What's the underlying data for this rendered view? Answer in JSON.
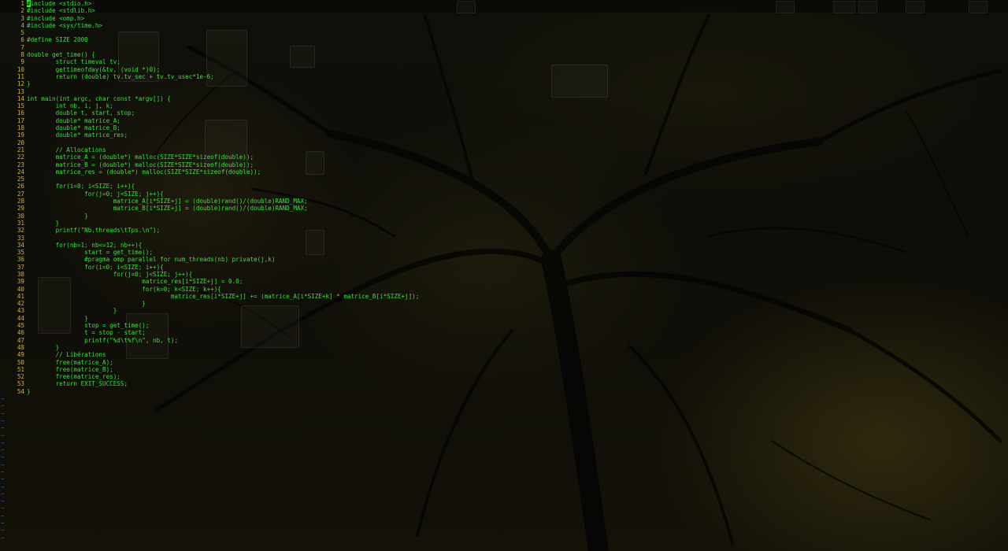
{
  "editor": {
    "lines": [
      {
        "num": "1",
        "text": "#include <stdio.h>"
      },
      {
        "num": "2",
        "text": "#include <stdlib.h>"
      },
      {
        "num": "3",
        "text": "#include <omp.h>"
      },
      {
        "num": "4",
        "text": "#include <sys/time.h>"
      },
      {
        "num": "5",
        "text": ""
      },
      {
        "num": "6",
        "text": "#define SIZE 2000"
      },
      {
        "num": "7",
        "text": ""
      },
      {
        "num": "8",
        "text": "double get_time() {"
      },
      {
        "num": "9",
        "text": "        struct timeval tv;"
      },
      {
        "num": "10",
        "text": "        gettimeofday(&tv, (void *)0);"
      },
      {
        "num": "11",
        "text": "        return (double) tv.tv_sec + tv.tv_usec*1e-6;"
      },
      {
        "num": "12",
        "text": "}"
      },
      {
        "num": "13",
        "text": ""
      },
      {
        "num": "14",
        "text": "int main(int argc, char const *argv[]) {"
      },
      {
        "num": "15",
        "text": "        int nb, i, j, k;"
      },
      {
        "num": "16",
        "text": "        double t, start, stop;"
      },
      {
        "num": "17",
        "text": "        double* matrice_A;"
      },
      {
        "num": "18",
        "text": "        double* matrice_B;"
      },
      {
        "num": "19",
        "text": "        double* matrice_res;"
      },
      {
        "num": "20",
        "text": ""
      },
      {
        "num": "21",
        "text": "        // Allocations"
      },
      {
        "num": "22",
        "text": "        matrice_A = (double*) malloc(SIZE*SIZE*sizeof(double));"
      },
      {
        "num": "23",
        "text": "        matrice_B = (double*) malloc(SIZE*SIZE*sizeof(double));"
      },
      {
        "num": "24",
        "text": "        matrice_res = (double*) malloc(SIZE*SIZE*sizeof(double));"
      },
      {
        "num": "25",
        "text": ""
      },
      {
        "num": "26",
        "text": "        for(i=0; i<SIZE; i++){"
      },
      {
        "num": "27",
        "text": "                for(j=0; j<SIZE; j++){"
      },
      {
        "num": "28",
        "text": "                        matrice_A[i*SIZE+j] = (double)rand()/(double)RAND_MAX;"
      },
      {
        "num": "29",
        "text": "                        matrice_B[i*SIZE+j] = (double)rand()/(double)RAND_MAX;"
      },
      {
        "num": "30",
        "text": "                }"
      },
      {
        "num": "31",
        "text": "        }"
      },
      {
        "num": "32",
        "text": "        printf(\"Nb.threads\\tTps.\\n\");"
      },
      {
        "num": "33",
        "text": ""
      },
      {
        "num": "34",
        "text": "        for(nb=1; nb<=12; nb++){"
      },
      {
        "num": "35",
        "text": "                start = get_time();"
      },
      {
        "num": "36",
        "text": "                #pragma omp parallel for num_threads(nb) private(j,k)"
      },
      {
        "num": "37",
        "text": "                for(i=0; i<SIZE; i++){"
      },
      {
        "num": "38",
        "text": "                        for(j=0; j<SIZE; j++){"
      },
      {
        "num": "39",
        "text": "                                matrice_res[i*SIZE+j] = 0.0;"
      },
      {
        "num": "40",
        "text": "                                for(k=0; k<SIZE; k++){"
      },
      {
        "num": "41",
        "text": "                                        matrice_res[i*SIZE+j] += (matrice_A[i*SIZE+k] * matrice_B[i*SIZE+j]);"
      },
      {
        "num": "42",
        "text": "                                }"
      },
      {
        "num": "43",
        "text": "                        }"
      },
      {
        "num": "44",
        "text": "                }"
      },
      {
        "num": "45",
        "text": "                stop = get_time();"
      },
      {
        "num": "46",
        "text": "                t = stop - start;"
      },
      {
        "num": "47",
        "text": "                printf(\"%d\\t%f\\n\", nb, t);"
      },
      {
        "num": "48",
        "text": "        }"
      },
      {
        "num": "49",
        "text": "        // Libérations"
      },
      {
        "num": "50",
        "text": "        free(matrice_A);"
      },
      {
        "num": "51",
        "text": "        free(matrice_B);"
      },
      {
        "num": "52",
        "text": "        free(matrice_res);"
      },
      {
        "num": "53",
        "text": "        return EXIT_SUCCESS;"
      },
      {
        "num": "54",
        "text": "}"
      }
    ],
    "tilde_marker": "~",
    "empty_line_markers": 20
  },
  "colors": {
    "code_text": "#39e23a",
    "line_number": "#d6b41c",
    "tilde": "#2f5fcf",
    "background": "#0b0b07"
  }
}
